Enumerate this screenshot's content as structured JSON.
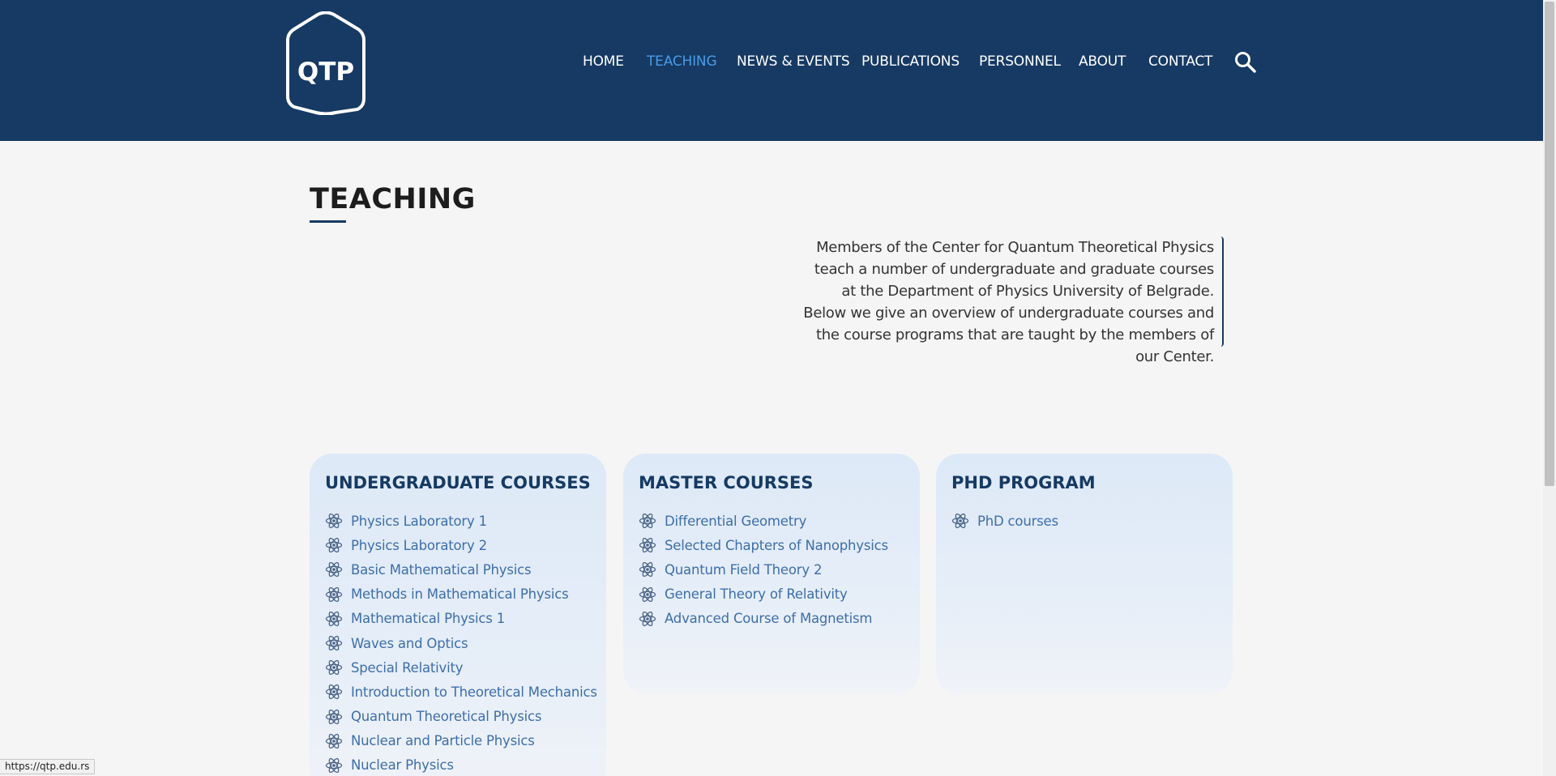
{
  "logo": {
    "text": "QTP"
  },
  "nav": {
    "items": [
      {
        "label": "HOME",
        "active": false
      },
      {
        "label": "TEACHING",
        "active": true
      },
      {
        "label": "NEWS & EVENTS",
        "active": false
      },
      {
        "label": "PUBLICATIONS",
        "active": false
      },
      {
        "label": "PERSONNEL",
        "active": false
      },
      {
        "label": "ABOUT",
        "active": false
      },
      {
        "label": "CONTACT",
        "active": false
      }
    ],
    "search_icon": "search-icon"
  },
  "page": {
    "title": "TEACHING",
    "intro": "Members of the Center for Quantum Theoretical Physics teach a number of undergraduate and graduate courses at the Department of Physics University of Belgrade. Below we give an overview of undergraduate courses and the course programs that are taught by the members of our Center."
  },
  "cards": {
    "undergraduate": {
      "title": "UNDERGRADUATE COURSES",
      "courses": [
        "Physics Laboratory 1",
        "Physics Laboratory 2",
        "Basic Mathematical Physics",
        "Methods in Mathematical Physics",
        "Mathematical Physics 1",
        "Waves and Optics",
        "Special Relativity",
        "Introduction to Theoretical Mechanics",
        "Quantum Theoretical Physics",
        "Nuclear and Particle Physics",
        "Nuclear Physics"
      ]
    },
    "master": {
      "title": "MASTER COURSES",
      "courses": [
        "Differential Geometry",
        "Selected Chapters of Nanophysics",
        "Quantum Field Theory 2",
        "General Theory of Relativity",
        "Advanced Course of Magnetism"
      ]
    },
    "phd": {
      "title": "PHD PROGRAM",
      "courses": [
        "PhD courses"
      ]
    }
  },
  "status_bar": {
    "url": "https://qtp.edu.rs"
  },
  "colors": {
    "header_bg": "#163a63",
    "nav_active": "#4a9be8",
    "link": "#3d6ea8",
    "page_bg": "#f5f5f5"
  },
  "icons": {
    "list_bullet": "atom-icon"
  }
}
